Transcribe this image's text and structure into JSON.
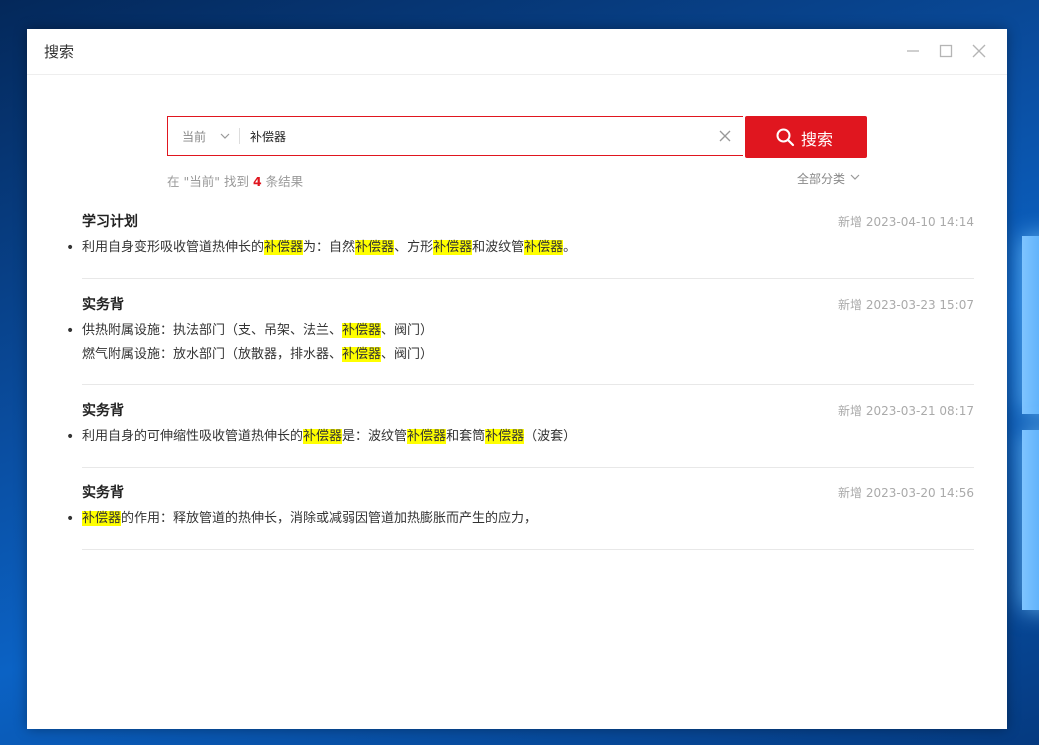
{
  "window": {
    "title": "搜索"
  },
  "search": {
    "scope": "当前",
    "query": "补偿器",
    "button_label": "搜索",
    "summary_prefix": "在 \"当前\" 找到",
    "summary_count": "4",
    "summary_suffix": "条结果",
    "category_filter": "全部分类"
  },
  "highlight_term": "补偿器",
  "results": [
    {
      "title": "学习计划",
      "date": "新增 2023-04-10 14:14",
      "lines": [
        {
          "bullet": true,
          "segments": [
            {
              "t": "利用自身变形吸收管道热伸长的",
              "h": false
            },
            {
              "t": "补偿器",
              "h": true
            },
            {
              "t": "为：自然",
              "h": false
            },
            {
              "t": "补偿器",
              "h": true
            },
            {
              "t": "、方形",
              "h": false
            },
            {
              "t": "补偿器",
              "h": true
            },
            {
              "t": "和波纹管",
              "h": false
            },
            {
              "t": "补偿器",
              "h": true
            },
            {
              "t": "。",
              "h": false
            }
          ]
        }
      ]
    },
    {
      "title": "实务背",
      "date": "新增 2023-03-23 15:07",
      "lines": [
        {
          "bullet": true,
          "segments": [
            {
              "t": "供热附属设施：执法部门（支、吊架、法兰、",
              "h": false
            },
            {
              "t": "补偿器",
              "h": true
            },
            {
              "t": "、阀门）",
              "h": false
            }
          ]
        },
        {
          "bullet": false,
          "segments": [
            {
              "t": "燃气附属设施：放水部门（放散器，排水器、",
              "h": false
            },
            {
              "t": "补偿器",
              "h": true
            },
            {
              "t": "、阀门）",
              "h": false
            }
          ]
        }
      ]
    },
    {
      "title": "实务背",
      "date": "新增 2023-03-21 08:17",
      "lines": [
        {
          "bullet": true,
          "segments": [
            {
              "t": "利用自身的可伸缩性吸收管道热伸长的",
              "h": false
            },
            {
              "t": "补偿器",
              "h": true
            },
            {
              "t": "是：波纹管",
              "h": false
            },
            {
              "t": "补偿器",
              "h": true
            },
            {
              "t": "和套筒",
              "h": false
            },
            {
              "t": "补偿器",
              "h": true
            },
            {
              "t": "（波套）",
              "h": false
            }
          ]
        }
      ]
    },
    {
      "title": "实务背",
      "date": "新增 2023-03-20 14:56",
      "lines": [
        {
          "bullet": true,
          "segments": [
            {
              "t": "补偿器",
              "h": true
            },
            {
              "t": "的作用：释放管道的热伸长，消除或减弱因管道加热膨胀而产生的应力，",
              "h": false
            }
          ]
        }
      ]
    }
  ],
  "icons": {
    "minimize": "minimize-icon",
    "maximize": "maximize-icon",
    "close": "close-icon",
    "scope_chevron": "chevron-down-icon",
    "clear": "clear-icon",
    "search": "search-icon",
    "category_chevron": "chevron-down-icon"
  },
  "colors": {
    "accent": "#e0161f",
    "highlight": "#ffff00",
    "meta_text": "#aaaaaa"
  }
}
